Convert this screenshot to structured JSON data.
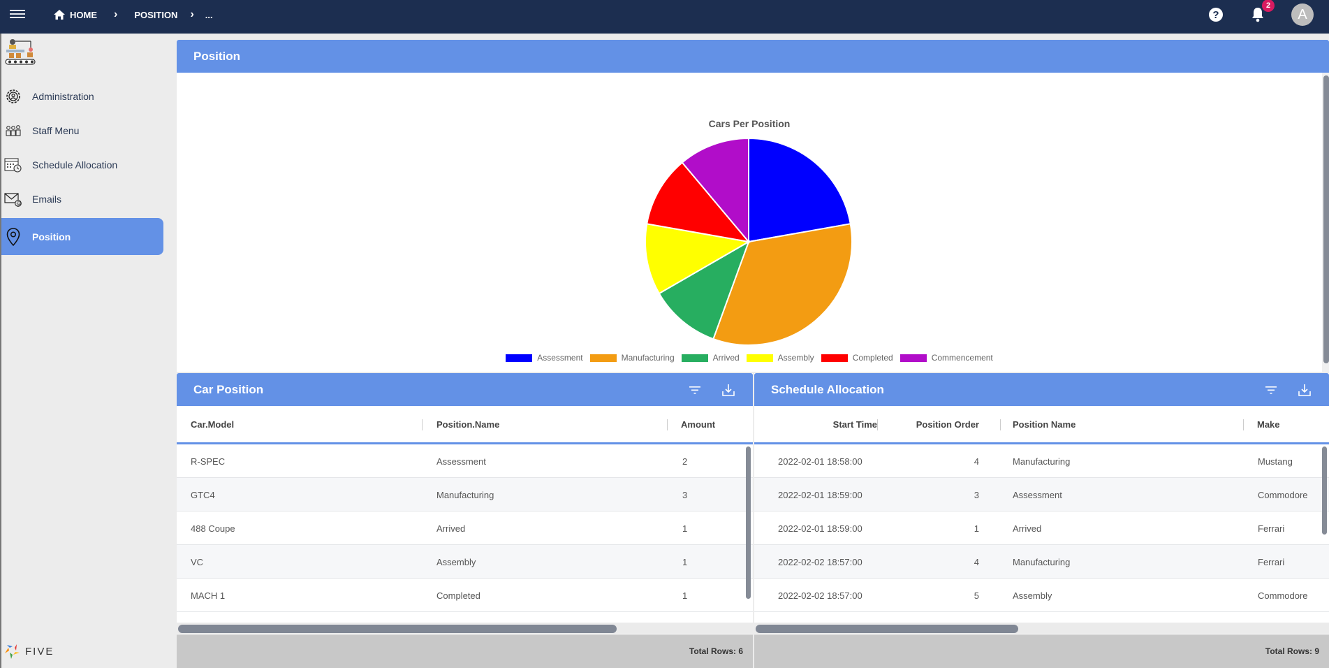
{
  "topbar": {
    "breadcrumb": [
      {
        "label": "HOME",
        "icon": "home-icon"
      },
      {
        "label": "POSITION"
      },
      {
        "label": "..."
      }
    ],
    "notification_count": "2",
    "avatar_initial": "A",
    "help_glyph": "?"
  },
  "sidebar": {
    "items": [
      {
        "label": "Administration",
        "icon": "admin-gear-icon",
        "active": false
      },
      {
        "label": "Staff Menu",
        "icon": "staff-icon",
        "active": false
      },
      {
        "label": "Schedule Allocation",
        "icon": "calendar-icon",
        "active": false
      },
      {
        "label": "Emails",
        "icon": "email-icon",
        "active": false
      },
      {
        "label": "Position",
        "icon": "location-pin-icon",
        "active": true
      }
    ],
    "brand": "FIVE"
  },
  "position_panel": {
    "title": "Position"
  },
  "chart_data": {
    "type": "pie",
    "title": "Cars Per Position",
    "categories": [
      "Assessment",
      "Manufacturing",
      "Arrived",
      "Assembly",
      "Completed",
      "Commencement"
    ],
    "values": [
      2,
      3,
      1,
      1,
      1,
      1
    ],
    "colors": [
      "#0000ff",
      "#f39c12",
      "#27ae60",
      "#ffff00",
      "#ff0000",
      "#b10dc9"
    ],
    "legend_position": "bottom",
    "start_angle": "12 o'clock, clockwise"
  },
  "car_position": {
    "title": "Car Position",
    "columns": [
      "Car.Model",
      "Position.Name",
      "Amount"
    ],
    "rows": [
      [
        "R-SPEC",
        "Assessment",
        "2"
      ],
      [
        "GTC4",
        "Manufacturing",
        "3"
      ],
      [
        "488 Coupe",
        "Arrived",
        "1"
      ],
      [
        "VC",
        "Assembly",
        "1"
      ],
      [
        "MACH 1",
        "Completed",
        "1"
      ]
    ],
    "total_rows": "Total Rows: 6"
  },
  "schedule_allocation": {
    "title": "Schedule Allocation",
    "columns": [
      "Start Time",
      "Position Order",
      "Position Name",
      "Make"
    ],
    "rows": [
      [
        "2022-02-01 18:58:00",
        "4",
        "Manufacturing",
        "Mustang"
      ],
      [
        "2022-02-01 18:59:00",
        "3",
        "Assessment",
        "Commodore"
      ],
      [
        "2022-02-01 18:59:00",
        "1",
        "Arrived",
        "Ferrari"
      ],
      [
        "2022-02-02 18:57:00",
        "4",
        "Manufacturing",
        "Ferrari"
      ],
      [
        "2022-02-02 18:57:00",
        "5",
        "Assembly",
        "Commodore"
      ]
    ],
    "total_rows": "Total Rows: 9"
  },
  "colors": {
    "topbar": "#1c2e50",
    "accent": "#6391e6",
    "badge": "#d81b60"
  }
}
